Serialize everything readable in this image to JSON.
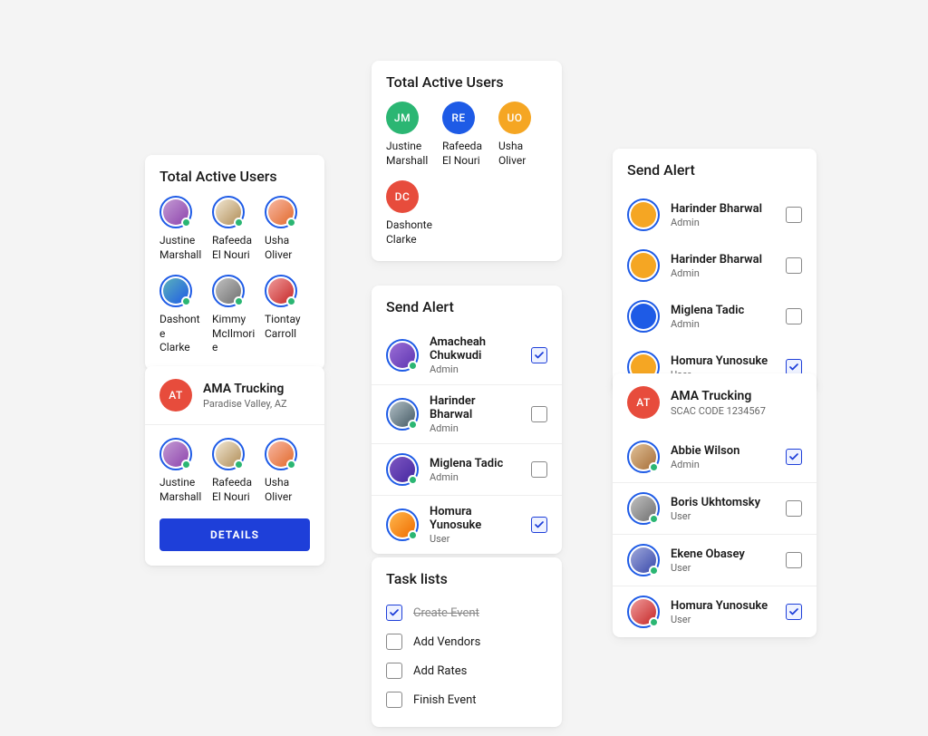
{
  "colors": {
    "blue": "#1e5be6",
    "green": "#2bb673",
    "amber": "#f5a623",
    "red": "#e74c3c",
    "primary_btn": "#1e3fd9"
  },
  "card_active1": {
    "title": "Total Active Users",
    "users": [
      {
        "name_l1": "Justine",
        "name_l2": "Marshall"
      },
      {
        "name_l1": "Rafeeda",
        "name_l2": "El Nouri"
      },
      {
        "name_l1": "Usha",
        "name_l2": "Oliver"
      },
      {
        "name_l1": "Dashonte",
        "name_l2": "Clarke"
      },
      {
        "name_l1": "Kimmy",
        "name_l2": "McIlmorie"
      },
      {
        "name_l1": "Tiontay",
        "name_l2": "Carroll"
      }
    ]
  },
  "card_active2": {
    "title": "Total Active Users",
    "users": [
      {
        "initials": "JM",
        "color": "#2bb673",
        "name_l1": "Justine",
        "name_l2": "Marshall"
      },
      {
        "initials": "RE",
        "color": "#1e5be6",
        "name_l1": "Rafeeda",
        "name_l2": "El Nouri"
      },
      {
        "initials": "UO",
        "color": "#f5a623",
        "name_l1": "Usha",
        "name_l2": "Oliver"
      },
      {
        "initials": "DC",
        "color": "#e74c3c",
        "name_l1": "Dashonte",
        "name_l2": "Clarke"
      }
    ]
  },
  "card_company": {
    "badge": "AT",
    "title": "AMA Trucking",
    "subtitle": "Paradise Valley, AZ",
    "users": [
      {
        "name_l1": "Justine",
        "name_l2": "Marshall"
      },
      {
        "name_l1": "Rafeeda",
        "name_l2": "El Nouri"
      },
      {
        "name_l1": "Usha",
        "name_l2": "Oliver"
      }
    ],
    "button": "DETAILS"
  },
  "card_alert1": {
    "title": "Send Alert",
    "rows": [
      {
        "name": "Amacheah Chukwudi",
        "role": "Admin",
        "checked": true
      },
      {
        "name": "Harinder Bharwal",
        "role": "Admin",
        "checked": false
      },
      {
        "name": "Miglena Tadic",
        "role": "Admin",
        "checked": false
      },
      {
        "name": "Homura Yunosuke",
        "role": "User",
        "checked": true
      }
    ]
  },
  "card_alert2": {
    "title": "Send Alert",
    "rows": [
      {
        "name": "Harinder Bharwal",
        "role": "Admin",
        "checked": false
      },
      {
        "name": "Harinder Bharwal",
        "role": "Admin",
        "checked": false
      },
      {
        "name": "Miglena Tadic",
        "role": "Admin",
        "checked": false
      },
      {
        "name": "Homura Yunosuke",
        "role": "User",
        "checked": true
      }
    ]
  },
  "card_scac": {
    "badge": "AT",
    "title": "AMA Trucking",
    "subtitle": "SCAC CODE 1234567",
    "rows": [
      {
        "name": "Abbie Wilson",
        "role": "Admin",
        "checked": true
      },
      {
        "name": "Boris Ukhtomsky",
        "role": "User",
        "checked": false
      },
      {
        "name": "Ekene Obasey",
        "role": "User",
        "checked": false
      },
      {
        "name": "Homura Yunosuke",
        "role": "User",
        "checked": true
      }
    ]
  },
  "card_tasks": {
    "title": "Task lists",
    "rows": [
      {
        "label": "Create Event",
        "checked": true,
        "done": true
      },
      {
        "label": "Add Vendors",
        "checked": false,
        "done": false
      },
      {
        "label": "Add Rates",
        "checked": false,
        "done": false
      },
      {
        "label": "Finish Event",
        "checked": false,
        "done": false
      }
    ]
  }
}
